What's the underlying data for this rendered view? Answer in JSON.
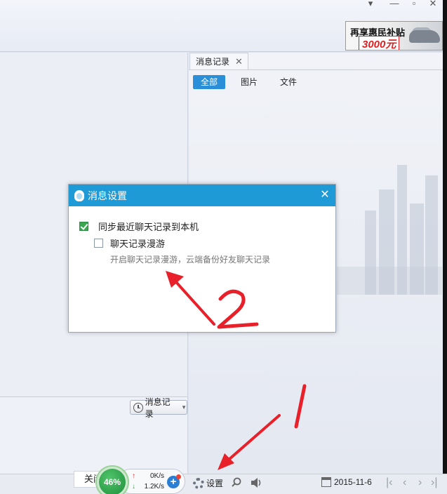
{
  "ad": {
    "line1": "再享惠民补贴",
    "line2": "3000元"
  },
  "log_panel": {
    "tab_label": "消息记录",
    "filters": [
      "全部",
      "图片",
      "文件"
    ]
  },
  "chat": {
    "msglog_button": "消息记录"
  },
  "bottom": {
    "close_label": "关闭",
    "speed_percent": "46%",
    "upload_speed": "0K/s",
    "download_speed": "1.2K/s",
    "settings_label": "设置",
    "date": "2015-11-6"
  },
  "dialog": {
    "title": "消息设置",
    "option_sync": "同步最近聊天记录到本机",
    "option_sync_checked": true,
    "option_roam": "聊天记录漫游",
    "option_roam_checked": false,
    "roam_hint": "开启聊天记录漫游，云端备份好友聊天记录"
  },
  "annotations": {
    "mark1": "1",
    "mark2": "2",
    "color": "#e8202a"
  }
}
